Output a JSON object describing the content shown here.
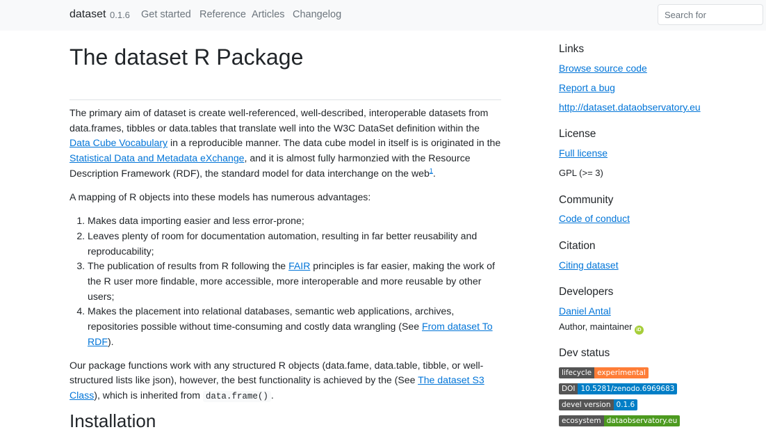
{
  "navbar": {
    "brand": "dataset",
    "version": "0.1.6",
    "links": [
      "Get started",
      "Reference",
      "Articles",
      "Changelog"
    ],
    "search_placeholder": "Search for"
  },
  "main": {
    "title": "The dataset R Package",
    "p1": {
      "t1": "The primary aim of dataset is create well-referenced, well-described, interoperable datasets from data.frames, tibbles or data.tables that translate well into the W3C DataSet definition within the ",
      "l1": "Data Cube Vocabulary",
      "t2": " in a reproducible manner. The data cube model in itself is is originated in the ",
      "l2": "Statistical Data and Metadata eXchange",
      "t3": ", and it is almost fully harmonzied with the Resource Description Framework (RDF), the standard model for data interchange on the web",
      "fn": "1",
      "t4": "."
    },
    "p2": "A mapping of R objects into these models has numerous advantages:",
    "list": {
      "i1": "Makes data importing easier and less error-prone;",
      "i2": "Leaves plenty of room for documentation automation, resulting in far better reusability and reproducability;",
      "i3a": "The publication of results from R following the ",
      "i3link": "FAIR",
      "i3b": " principles is far easier, making the work of the R user more findable, more accessible, more interoperable and more reusable by other users;",
      "i4a": "Makes the placement into relational databases, semantic web applications, archives, repositories possible without time-consuming and costly data wrangling (See ",
      "i4link": "From dataset To RDF",
      "i4b": ")."
    },
    "p3": {
      "t1": "Our package functions work with any structured R objects (data.fame, data.table, tibble, or well-structured lists like json), however, the best functionality is achieved by the (See ",
      "l1": "The dataset S3 Class",
      "t2": "), which is inherited from ",
      "code": "data.frame()",
      "t3": "."
    },
    "h2": "Installation"
  },
  "sidebar": {
    "links_heading": "Links",
    "links": [
      "Browse source code",
      "Report a bug",
      "http://dataset.dataobservatory.eu"
    ],
    "license_heading": "License",
    "license_link": "Full license",
    "license_text": "GPL (>= 3)",
    "community_heading": "Community",
    "community_link": "Code of conduct",
    "citation_heading": "Citation",
    "citation_link": "Citing dataset",
    "developers_heading": "Developers",
    "developer_name": "Daniel Antal",
    "developer_role": "Author, maintainer",
    "orcid_icon_text": "iD",
    "devstatus_heading": "Dev status",
    "badges": [
      {
        "key": "lifecycle",
        "value": "experimental",
        "color": "#fe7d37"
      },
      {
        "key": "DOI",
        "value": "10.5281/zenodo.6969683",
        "color": "#007ec6"
      },
      {
        "key": "devel version",
        "value": "0.1.6",
        "color": "#007ec6"
      },
      {
        "key": "ecosystem",
        "value": "dataobservatory.eu",
        "color": "#4c9a1f"
      }
    ]
  }
}
